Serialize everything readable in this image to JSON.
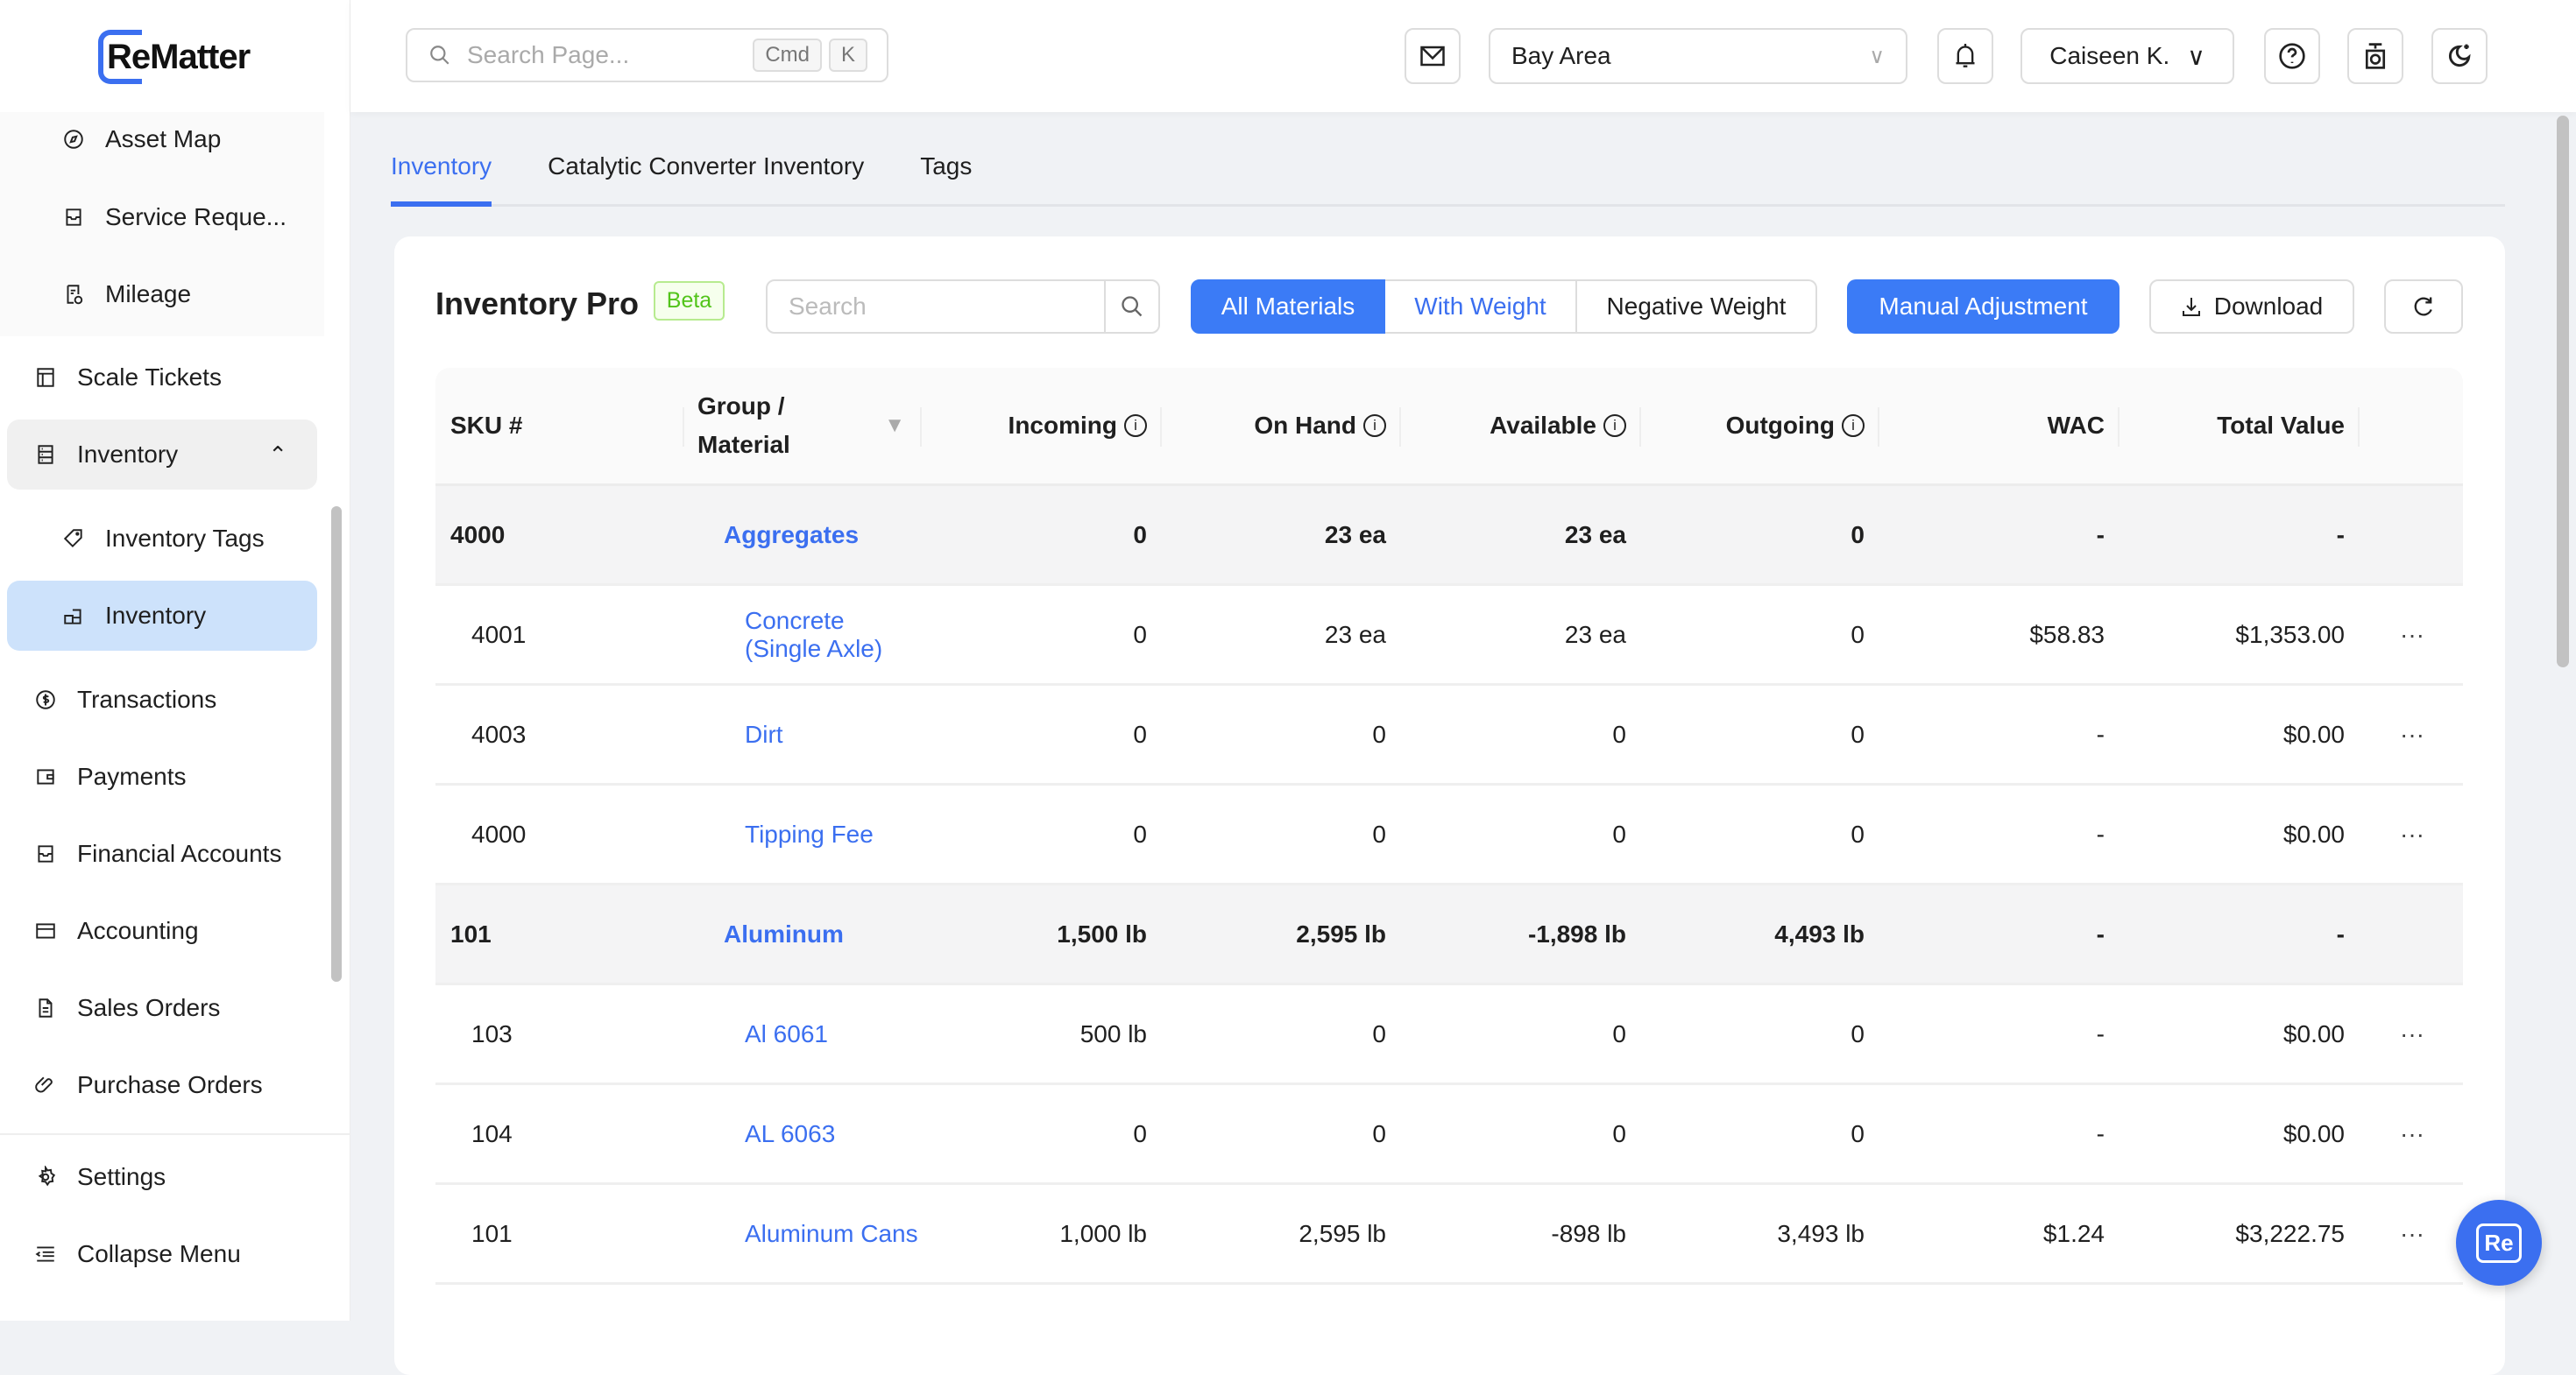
{
  "brand": {
    "name": "ReMatter",
    "accent": "#3b6ff0"
  },
  "sidebar": {
    "sub_items": [
      {
        "label": "Asset Map",
        "icon": "compass-icon"
      },
      {
        "label": "Service Reque...",
        "icon": "inbox-icon"
      },
      {
        "label": "Mileage",
        "icon": "receipt-check-icon"
      }
    ],
    "items": [
      {
        "label": "Scale Tickets",
        "icon": "ticket-icon"
      },
      {
        "label": "Inventory",
        "icon": "inventory-icon",
        "expanded": true
      },
      {
        "label": "Inventory Tags",
        "icon": "tag-icon",
        "child": true
      },
      {
        "label": "Inventory",
        "icon": "boxes-icon",
        "child": true,
        "active": true
      },
      {
        "label": "Transactions",
        "icon": "dollar-icon"
      },
      {
        "label": "Payments",
        "icon": "wallet-icon"
      },
      {
        "label": "Financial Accounts",
        "icon": "bank-icon"
      },
      {
        "label": "Accounting",
        "icon": "card-icon"
      },
      {
        "label": "Sales Orders",
        "icon": "document-icon"
      },
      {
        "label": "Purchase Orders",
        "icon": "paperclip-icon"
      }
    ],
    "settings": "Settings",
    "collapse": "Collapse Menu"
  },
  "header": {
    "search_placeholder": "Search Page...",
    "kbd1": "Cmd",
    "kbd2": "K",
    "location": "Bay Area",
    "user": "Caiseen K."
  },
  "tabs": [
    {
      "label": "Inventory",
      "active": true
    },
    {
      "label": "Catalytic Converter Inventory"
    },
    {
      "label": "Tags"
    }
  ],
  "main": {
    "title": "Inventory Pro",
    "badge": "Beta",
    "search_placeholder": "Search",
    "filters": [
      {
        "label": "All Materials",
        "selected": true
      },
      {
        "label": "With Weight"
      },
      {
        "label": "Negative Weight"
      }
    ],
    "manual": "Manual Adjustment",
    "download": "Download"
  },
  "table": {
    "columns": [
      "SKU #",
      "Group / Material",
      "Incoming",
      "On Hand",
      "Available",
      "Outgoing",
      "WAC",
      "Total Value"
    ],
    "rows": [
      {
        "group": true,
        "sku": "4000",
        "name": "Aggregates",
        "incoming": "0",
        "on_hand": "23 ea",
        "available": "23 ea",
        "outgoing": "0",
        "wac": "-",
        "total": "-"
      },
      {
        "sku": "4001",
        "name": "Concrete (Single Axle)",
        "incoming": "0",
        "on_hand": "23 ea",
        "available": "23 ea",
        "outgoing": "0",
        "wac": "$58.83",
        "total": "$1,353.00"
      },
      {
        "sku": "4003",
        "name": "Dirt",
        "incoming": "0",
        "on_hand": "0",
        "available": "0",
        "outgoing": "0",
        "wac": "-",
        "total": "$0.00"
      },
      {
        "sku": "4000",
        "name": "Tipping Fee",
        "incoming": "0",
        "on_hand": "0",
        "available": "0",
        "outgoing": "0",
        "wac": "-",
        "total": "$0.00"
      },
      {
        "group": true,
        "sku": "101",
        "name": "Aluminum",
        "incoming": "1,500 lb",
        "on_hand": "2,595 lb",
        "available": "-1,898 lb",
        "outgoing": "4,493 lb",
        "wac": "-",
        "total": "-"
      },
      {
        "sku": "103",
        "name": "Al 6061",
        "incoming": "500 lb",
        "on_hand": "0",
        "available": "0",
        "outgoing": "0",
        "wac": "-",
        "total": "$0.00"
      },
      {
        "sku": "104",
        "name": "AL 6063",
        "incoming": "0",
        "on_hand": "0",
        "available": "0",
        "outgoing": "0",
        "wac": "-",
        "total": "$0.00"
      },
      {
        "sku": "101",
        "name": "Aluminum Cans",
        "incoming": "1,000 lb",
        "on_hand": "2,595 lb",
        "available": "-898 lb",
        "outgoing": "3,493 lb",
        "wac": "$1.24",
        "total": "$3,222.75"
      }
    ],
    "row_action": "···"
  },
  "chat": {
    "label": "Re"
  }
}
